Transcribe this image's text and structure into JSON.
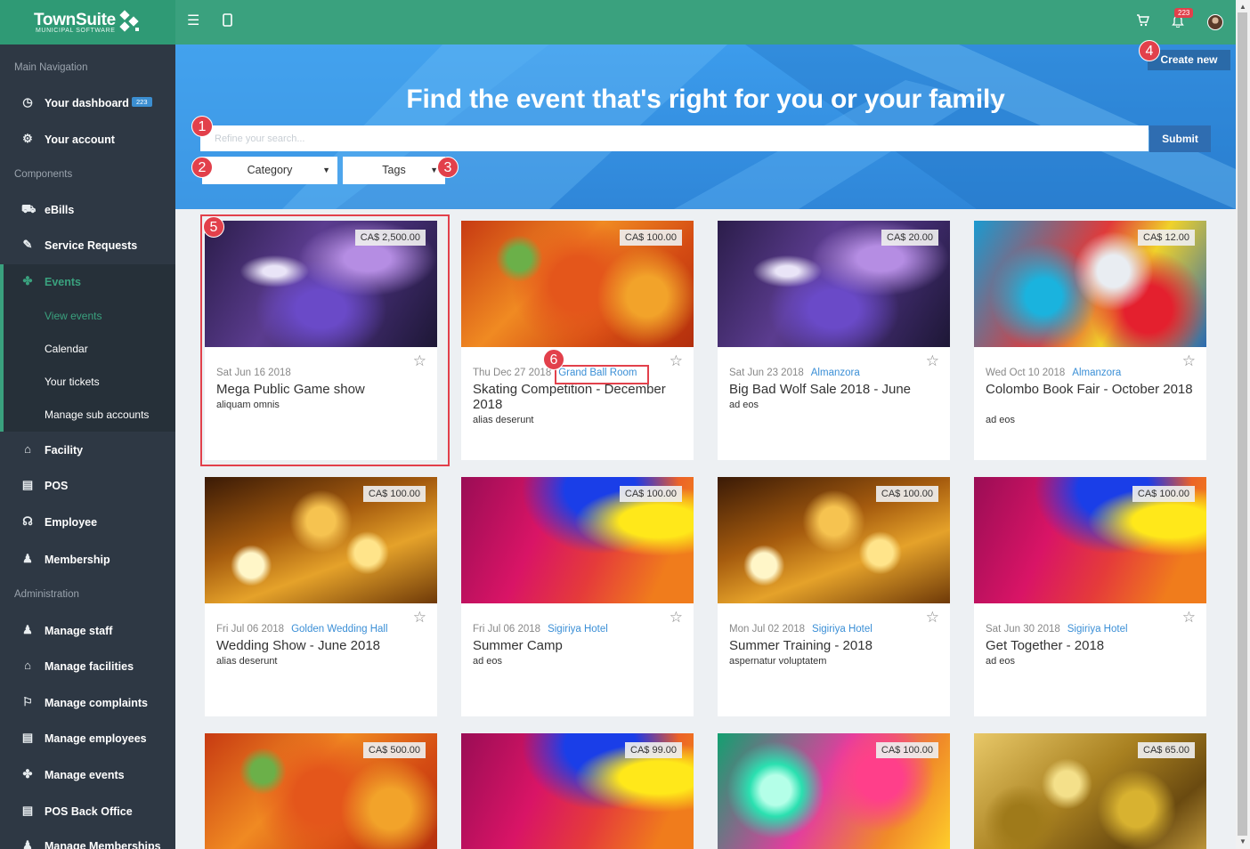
{
  "app": {
    "brand": "TownSuite",
    "brand_sub": "MUNICIPAL SOFTWARE"
  },
  "topbar": {
    "notifications_count": "223",
    "icons": [
      "menu-icon",
      "mobile-icon",
      "cart-icon",
      "bell-icon",
      "avatar"
    ]
  },
  "sidebar": {
    "sections": {
      "main": "Main Navigation",
      "components": "Components",
      "administration": "Administration"
    },
    "dashboard_badge": "223",
    "items": [
      {
        "label": "Your dashboard",
        "icon": "dashboard-icon"
      },
      {
        "label": "Your account",
        "icon": "gear-icon"
      },
      {
        "label": "eBills",
        "icon": "bills-icon"
      },
      {
        "label": "Service Requests",
        "icon": "edit-icon"
      },
      {
        "label": "Events",
        "icon": "events-icon"
      },
      {
        "label": "Facility",
        "icon": "home-icon"
      },
      {
        "label": "POS",
        "icon": "pos-icon"
      },
      {
        "label": "Employee",
        "icon": "headset-icon"
      },
      {
        "label": "Membership",
        "icon": "user-icon"
      },
      {
        "label": "Manage staff",
        "icon": "staff-icon"
      },
      {
        "label": "Manage facilities",
        "icon": "home-icon"
      },
      {
        "label": "Manage complaints",
        "icon": "flag-icon"
      },
      {
        "label": "Manage employees",
        "icon": "employees-icon"
      },
      {
        "label": "Manage events",
        "icon": "events-icon"
      },
      {
        "label": "POS Back Office",
        "icon": "pos-icon"
      },
      {
        "label": "Manage Memberships",
        "icon": "user-icon"
      }
    ],
    "events_sub": [
      "View events",
      "Calendar",
      "Your tickets",
      "Manage sub accounts"
    ]
  },
  "hero": {
    "title": "Find the event that's right for you or your family",
    "search_placeholder": "Refine your search...",
    "submit": "Submit",
    "category": "Category",
    "tags": "Tags",
    "create_new": "Create new"
  },
  "callouts": [
    "1",
    "2",
    "3",
    "4",
    "5",
    "6"
  ],
  "events": [
    {
      "price": "CA$ 2,500.00",
      "date": "Sat Jun 16 2018",
      "venue": "",
      "title": "Mega Public Game show",
      "desc": "aliquam omnis",
      "image": "purple"
    },
    {
      "price": "CA$ 100.00",
      "date": "Thu Dec 27 2018",
      "venue": "Grand Ball Room",
      "title": "Skating Competition - December 2018",
      "desc": "alias deserunt",
      "image": "orange"
    },
    {
      "price": "CA$ 20.00",
      "date": "Sat Jun 23 2018",
      "venue": "Almanzora",
      "title": "Big Bad Wolf Sale 2018 - June",
      "desc": "ad eos",
      "image": "purple"
    },
    {
      "price": "CA$ 12.00",
      "date": "Wed Oct 10 2018",
      "venue": "Almanzora",
      "title": "Colombo Book Fair - October 2018",
      "desc": "ad eos",
      "image": "paint"
    },
    {
      "price": "CA$ 100.00",
      "date": "Fri Jul 06 2018",
      "venue": "Golden Wedding Hall",
      "title": "Wedding Show - June 2018",
      "desc": "alias deserunt",
      "image": "bokeh"
    },
    {
      "price": "CA$ 100.00",
      "date": "Fri Jul 06 2018",
      "venue": "Sigiriya Hotel",
      "title": "Summer Camp",
      "desc": "ad eos",
      "image": "rainbow"
    },
    {
      "price": "CA$ 100.00",
      "date": "Mon Jul 02 2018",
      "venue": "Sigiriya Hotel",
      "title": "Summer Training - 2018",
      "desc": "aspernatur voluptatem",
      "image": "bokeh"
    },
    {
      "price": "CA$ 100.00",
      "date": "Sat Jun 30 2018",
      "venue": "Sigiriya Hotel",
      "title": "Get Together - 2018",
      "desc": "ad eos",
      "image": "rainbow"
    },
    {
      "price": "CA$ 500.00",
      "image": "orange"
    },
    {
      "price": "CA$ 99.00",
      "image": "rainbow"
    },
    {
      "price": "CA$ 100.00",
      "image": "neon"
    },
    {
      "price": "CA$ 65.00",
      "image": "oil"
    }
  ]
}
